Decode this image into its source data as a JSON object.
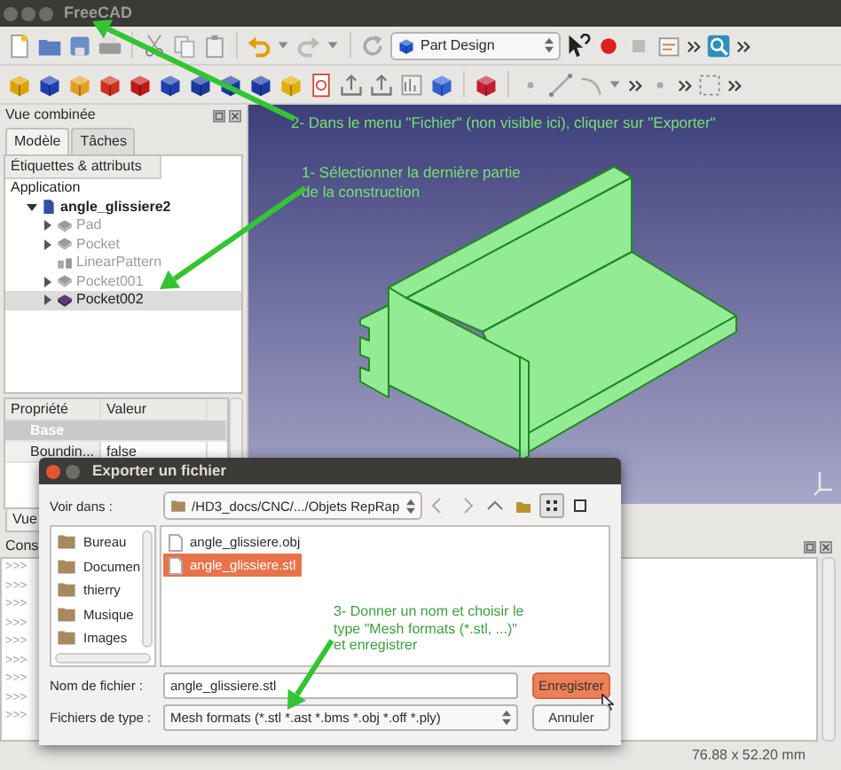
{
  "window": {
    "title": "FreeCAD"
  },
  "toolbar": {
    "workbench": "Part Design"
  },
  "combo_view": {
    "title": "Vue combinée",
    "tabs": [
      {
        "label": "Modèle",
        "selected": true
      },
      {
        "label": "Tâches",
        "selected": false
      }
    ],
    "tree_header": "Étiquettes & attributs",
    "tree": [
      {
        "label": "Application",
        "kind": "application",
        "children": [
          {
            "label": "angle_glissiere2",
            "kind": "document",
            "expanded": true,
            "children": [
              {
                "label": "Pad",
                "kind": "solid",
                "expandable": true,
                "hidden": true,
                "selected": false
              },
              {
                "label": "Pocket",
                "kind": "solid",
                "expandable": true,
                "hidden": true,
                "selected": false
              },
              {
                "label": "LinearPattern",
                "kind": "pattern",
                "expandable": false,
                "hidden": true,
                "selected": false
              },
              {
                "label": "Pocket001",
                "kind": "solid",
                "expandable": true,
                "hidden": true,
                "selected": false
              },
              {
                "label": "Pocket002",
                "kind": "solid",
                "expandable": true,
                "hidden": false,
                "selected": true
              }
            ]
          }
        ]
      }
    ],
    "property_columns": [
      "Propriété",
      "Valeur"
    ],
    "property_rows": [
      {
        "kind": "group",
        "label": "Base"
      },
      {
        "kind": "property",
        "name": "Boundin...",
        "value": "false"
      }
    ],
    "bottom_tab": "Vue"
  },
  "view_annotations": [
    {
      "lines": [
        "2- Dans le menu \"Fichier\" (non visible ici), cliquer sur \"Exporter\""
      ]
    },
    {
      "lines": [
        "1- Sélectionner la dernière partie",
        "de la construction"
      ]
    }
  ],
  "console": {
    "title": "Cons",
    "prompts": [
      ">>>",
      ">>>",
      ">>>",
      ">>>",
      ">>>",
      ">>>",
      ">>>",
      ">>>",
      ">>>"
    ]
  },
  "status_bar": {
    "dimensions": "76.88 x 52.20 mm"
  },
  "dialog": {
    "title": "Exporter un fichier",
    "look_in_label": "Voir dans :",
    "path": "/HD3_docs/CNC/.../Objets RepRap",
    "places": [
      "Bureau",
      "Documen",
      "thierry",
      "Musique",
      "Images"
    ],
    "files": [
      {
        "name": "angle_glissiere.obj",
        "selected": false
      },
      {
        "name": "angle_glissiere.stl",
        "selected": true
      }
    ],
    "annotation": {
      "lines": [
        "3- Donner un nom et choisir le",
        "type \"Mesh formats (*.stl, ...)\"",
        "et enregistrer"
      ]
    },
    "filename_label": "Nom de fichier :",
    "filename": "angle_glissiere.stl",
    "filetype_label": "Fichiers de type :",
    "filetype": "Mesh formats (*.stl *.ast *.bms *.obj *.off *.ply)",
    "buttons": [
      {
        "label": "Enregistrer",
        "default": true
      },
      {
        "label": "Annuler",
        "default": false
      }
    ]
  }
}
